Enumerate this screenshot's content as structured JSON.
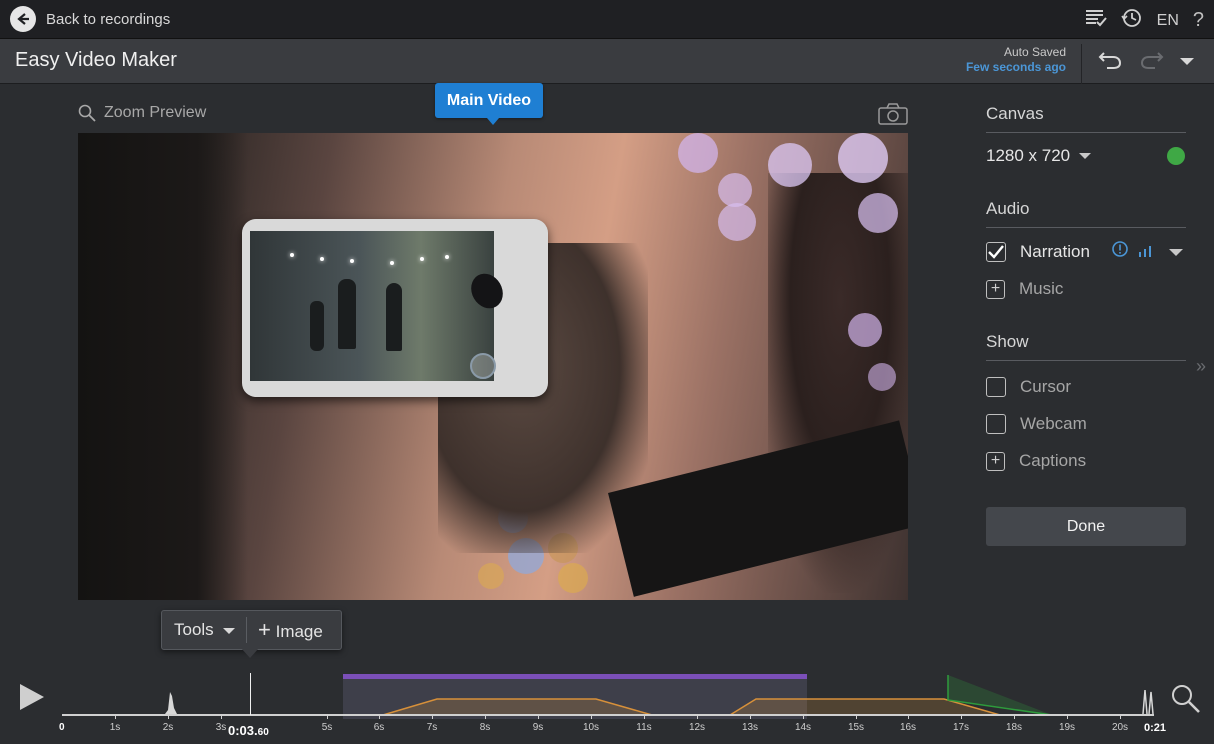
{
  "topbar": {
    "back_label": "Back to recordings",
    "language": "EN",
    "help": "?"
  },
  "titlebar": {
    "app_title": "Easy Video Maker",
    "autosave_status": "Auto Saved",
    "autosave_time": "Few seconds ago"
  },
  "preview": {
    "zoom_label": "Zoom Preview",
    "tag_label": "Main Video"
  },
  "canvas": {
    "title": "Canvas",
    "resolution": "1280 x 720",
    "status_color": "#3fa845"
  },
  "audio": {
    "title": "Audio",
    "narration_label": "Narration",
    "narration_checked": true,
    "music_label": "Music"
  },
  "show": {
    "title": "Show",
    "cursor_label": "Cursor",
    "webcam_label": "Webcam",
    "captions_label": "Captions"
  },
  "done_label": "Done",
  "tools": {
    "tools_label": "Tools",
    "image_label": "Image"
  },
  "timeline": {
    "current_time_main": "0:03.",
    "current_time_fraction": "60",
    "start_label": "0",
    "end_label": "0:21",
    "ticks": [
      "1s",
      "2s",
      "3s",
      "5s",
      "6s",
      "7s",
      "8s",
      "9s",
      "10s",
      "11s",
      "12s",
      "13s",
      "14s",
      "15s",
      "16s",
      "17s",
      "18s",
      "19s",
      "20s"
    ]
  },
  "colors": {
    "accent": "#1f7fd3",
    "link": "#4b96d6",
    "clip_purple": "#7b4fb8",
    "audio_orange": "#d7903a",
    "fade_green": "#2e9b3c"
  }
}
